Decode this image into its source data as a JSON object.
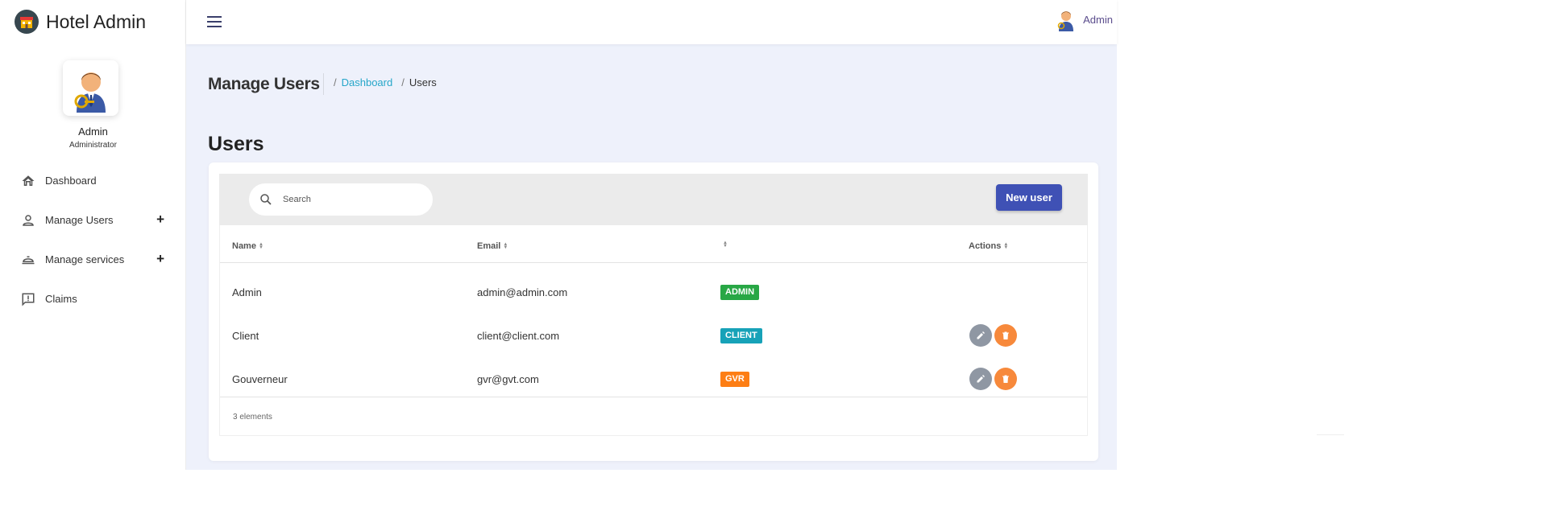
{
  "brand": {
    "title": "Hotel Admin"
  },
  "profile": {
    "name": "Admin",
    "role": "Administrator"
  },
  "sidebar": {
    "items": [
      {
        "label": "Dashboard",
        "icon": "home-icon",
        "expandable": false
      },
      {
        "label": "Manage Users",
        "icon": "person-icon",
        "expandable": true,
        "expand_symbol": "+"
      },
      {
        "label": "Manage services",
        "icon": "service-bell-icon",
        "expandable": true,
        "expand_symbol": "+"
      },
      {
        "label": "Claims",
        "icon": "feedback-icon",
        "expandable": false
      }
    ]
  },
  "topbar": {
    "user_name": "Admin"
  },
  "page": {
    "title": "Manage Users",
    "breadcrumb": {
      "sep": "/",
      "link": "Dashboard",
      "current": "Users"
    },
    "section_title": "Users"
  },
  "toolbar": {
    "search_placeholder": "Search",
    "new_user_label": "New user"
  },
  "table": {
    "headers": [
      "Name",
      "Email",
      "",
      "Actions"
    ],
    "rows": [
      {
        "name": "Admin",
        "email": "admin@admin.com",
        "role": "ADMIN",
        "role_color": "#28a745",
        "actions": false
      },
      {
        "name": "Client",
        "email": "client@client.com",
        "role": "CLIENT",
        "role_color": "#17a2b8",
        "actions": true
      },
      {
        "name": "Gouverneur",
        "email": "gvr@gvt.com",
        "role": "GVR",
        "role_color": "#fd7e14",
        "actions": true
      }
    ],
    "footer": "3 elements"
  },
  "colors": {
    "primary": "#3f51b5",
    "link": "#26a6c9",
    "background": "#eef1fb",
    "edit": "#8f97a3",
    "delete": "#f7893b"
  }
}
